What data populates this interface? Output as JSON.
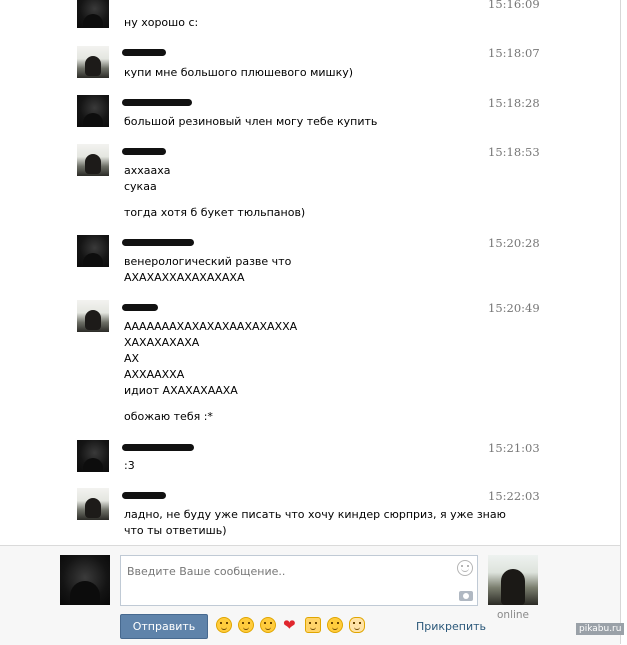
{
  "messages": [
    {
      "time": "15:16:09",
      "lines": [
        "ну хорошо с:"
      ]
    },
    {
      "time": "15:18:07",
      "lines": [
        "купи мне большого плюшевого мишку)"
      ]
    },
    {
      "time": "15:18:28",
      "lines": [
        "большой резиновый член могу тебе купить"
      ]
    },
    {
      "time": "15:18:53",
      "lines": [
        "аххааха",
        "сукаа",
        "тогда хотя б букет тюльпанов)"
      ]
    },
    {
      "time": "15:20:28",
      "lines": [
        "венерологический разве что",
        "АХАХАХХАХАХАХАХА"
      ]
    },
    {
      "time": "15:20:49",
      "lines": [
        "АААААААХАХАХАХААХАХАХХА",
        "ХАХАХАХАХА",
        "АХ",
        "АХХААХХА",
        "идиот АХАХАХААХА",
        "обожаю тебя :*"
      ]
    },
    {
      "time": "15:21:03",
      "lines": [
        ":3"
      ]
    },
    {
      "time": "15:22:03",
      "lines": [
        "ладно, не буду уже писать что хочу киндер сюрприз, я уже знаю",
        "что ты ответишь)"
      ]
    }
  ],
  "composer": {
    "placeholder": "Введите Ваше сообщение..",
    "send_label": "Отправить",
    "attach_label": "Прикрепить",
    "peer_status": "online",
    "emoji_icons": [
      "kissing-face-icon",
      "crying-face-icon",
      "kissing-closed-eyes-icon",
      "heart-icon",
      "thumbs-up-icon",
      "smile-icon",
      "ok-hand-icon"
    ]
  },
  "watermark": "pikabu.ru",
  "colors": {
    "send_button": "#5f83aa",
    "link": "#2b587a",
    "timestamp": "#777777"
  }
}
